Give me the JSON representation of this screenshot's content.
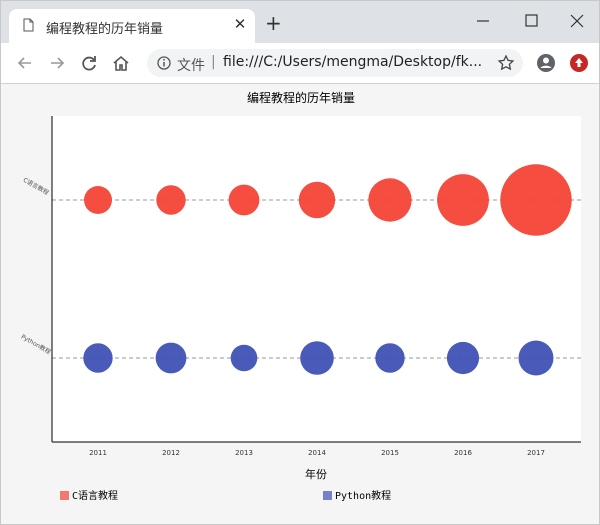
{
  "browser": {
    "tab_title": "编程教程的历年销量",
    "close_glyph": "✕",
    "newtab_glyph": "+",
    "omnibox_label": "文件",
    "separator": "|",
    "url": "file:///C:/Users/mengma/Desktop/fk..."
  },
  "icons": {
    "tab": "document-icon",
    "back": "back-arrow-icon",
    "forward": "forward-arrow-icon",
    "reload": "reload-icon",
    "home": "home-icon",
    "info": "info-icon",
    "star": "star-icon",
    "account": "account-icon",
    "extension": "extension-icon",
    "minimize": "minimize-icon",
    "maximize": "maximize-icon",
    "close": "close-icon"
  },
  "colors": {
    "series_c": "#f44336",
    "series_python": "#3f51b5",
    "extension_badge": "#c62828"
  },
  "chart_data": {
    "type": "scatter",
    "title": "编程教程的历年销量",
    "xlabel": "年份",
    "ylabel": "",
    "categories": [
      "2011",
      "2012",
      "2013",
      "2014",
      "2015",
      "2016",
      "2017"
    ],
    "y_categories": [
      "Python教程",
      "C语言教程"
    ],
    "series": [
      {
        "name": "C语言教程",
        "values": [
          20,
          21,
          22,
          26,
          31,
          37,
          51
        ]
      },
      {
        "name": "Python教程",
        "values": [
          21,
          22,
          19,
          24,
          21,
          23,
          25
        ]
      }
    ],
    "grid": "horizontal dashed",
    "legend": "bottom"
  }
}
